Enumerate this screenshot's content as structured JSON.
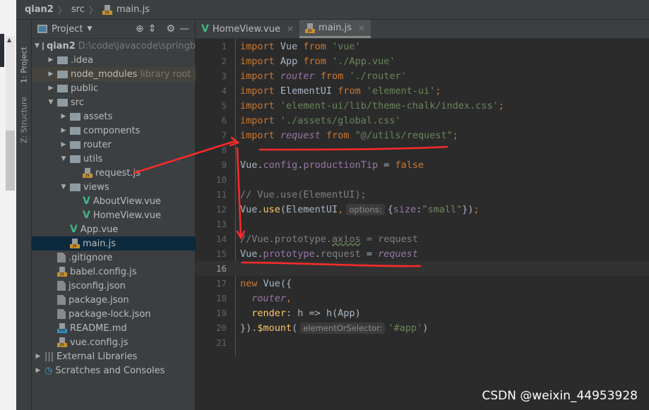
{
  "breadcrumb": [
    "qian2",
    "src",
    "main.js"
  ],
  "toolwindows": {
    "project": "1: Project",
    "structure": "Z: Structure"
  },
  "project_panel": {
    "title": "Project"
  },
  "tree": [
    {
      "label": "qian2",
      "extra": "D:\\code\\javacode\\springb",
      "depth": 0,
      "type": "root",
      "open": true
    },
    {
      "label": ".idea",
      "depth": 1,
      "type": "folder"
    },
    {
      "label": "node_modules",
      "extra": "library root",
      "depth": 1,
      "type": "folder",
      "lib": true
    },
    {
      "label": "public",
      "depth": 1,
      "type": "folder"
    },
    {
      "label": "src",
      "depth": 1,
      "type": "folder",
      "open": true
    },
    {
      "label": "assets",
      "depth": 2,
      "type": "folder"
    },
    {
      "label": "components",
      "depth": 2,
      "type": "folder"
    },
    {
      "label": "router",
      "depth": 2,
      "type": "folder"
    },
    {
      "label": "utils",
      "depth": 2,
      "type": "folder",
      "open": true
    },
    {
      "label": "request.js",
      "depth": 3,
      "type": "js"
    },
    {
      "label": "views",
      "depth": 2,
      "type": "folder",
      "open": true
    },
    {
      "label": "AboutView.vue",
      "depth": 3,
      "type": "vue"
    },
    {
      "label": "HomeView.vue",
      "depth": 3,
      "type": "vue"
    },
    {
      "label": "App.vue",
      "depth": 2,
      "type": "vue"
    },
    {
      "label": "main.js",
      "depth": 2,
      "type": "js",
      "selected": true
    },
    {
      "label": ".gitignore",
      "depth": 1,
      "type": "file"
    },
    {
      "label": "babel.config.js",
      "depth": 1,
      "type": "js"
    },
    {
      "label": "jsconfig.json",
      "depth": 1,
      "type": "file"
    },
    {
      "label": "package.json",
      "depth": 1,
      "type": "file"
    },
    {
      "label": "package-lock.json",
      "depth": 1,
      "type": "file"
    },
    {
      "label": "README.md",
      "depth": 1,
      "type": "md"
    },
    {
      "label": "vue.config.js",
      "depth": 1,
      "type": "js"
    },
    {
      "label": "External Libraries",
      "depth": 0,
      "type": "libs"
    },
    {
      "label": "Scratches and Consoles",
      "depth": 0,
      "type": "scratch"
    }
  ],
  "tabs": [
    {
      "label": "HomeView.vue",
      "icon": "vue-icon"
    },
    {
      "label": "main.js",
      "icon": "js-icon",
      "active": true
    }
  ],
  "current_line": 16,
  "code": [
    [
      [
        "kw",
        "import "
      ],
      [
        "id",
        "Vue "
      ],
      [
        "kw",
        "from "
      ],
      [
        "str",
        "'vue'"
      ]
    ],
    [
      [
        "kw",
        "import "
      ],
      [
        "id",
        "App "
      ],
      [
        "kw",
        "from "
      ],
      [
        "str",
        "'./App.vue'"
      ]
    ],
    [
      [
        "kw",
        "import "
      ],
      [
        "pv",
        "router"
      ],
      [
        "kw",
        " from "
      ],
      [
        "str",
        "'./router'"
      ]
    ],
    [
      [
        "kw",
        "import "
      ],
      [
        "id",
        "ElementUI "
      ],
      [
        "kw",
        "from "
      ],
      [
        "str",
        "'element-ui'"
      ],
      [
        "kw",
        ";"
      ]
    ],
    [
      [
        "kw",
        "import "
      ],
      [
        "str",
        "'element-ui/lib/theme-chalk/index.css'"
      ],
      [
        "kw",
        ";"
      ]
    ],
    [
      [
        "kw",
        "import "
      ],
      [
        "str",
        "'./assets/global.css'"
      ]
    ],
    [
      [
        "kw",
        "import "
      ],
      [
        "pv",
        "request"
      ],
      [
        "kw",
        " from "
      ],
      [
        "str",
        "\"@/utils/request\""
      ],
      [
        "kw",
        ";"
      ]
    ],
    [],
    [
      [
        "id",
        "Vue."
      ],
      [
        "prop",
        "config"
      ],
      [
        "id",
        "."
      ],
      [
        "prop",
        "productionTip"
      ],
      [
        "id",
        " = "
      ],
      [
        "kw",
        "false"
      ]
    ],
    [],
    [
      [
        "cm",
        "// Vue.use(ElementUI);"
      ]
    ],
    [
      [
        "id",
        "Vue."
      ],
      [
        "fn",
        "use"
      ],
      [
        "id",
        "(ElementUI"
      ],
      [
        "kw",
        ","
      ],
      [
        "hint",
        "options:"
      ],
      [
        "id",
        "{"
      ],
      [
        "prop",
        "size"
      ],
      [
        "id",
        ":"
      ],
      [
        "str",
        "\"small\""
      ],
      [
        "id",
        "})"
      ],
      [
        "kw",
        ";"
      ]
    ],
    [],
    [
      [
        "cm",
        "//Vue.prototype."
      ],
      [
        "wavy",
        "axios"
      ],
      [
        "cm",
        " = request"
      ]
    ],
    [
      [
        "id",
        "Vue."
      ],
      [
        "prop",
        "prototype"
      ],
      [
        "id",
        "."
      ],
      [
        "cm",
        "request"
      ],
      [
        "id",
        " = "
      ],
      [
        "pv",
        "request"
      ]
    ],
    [],
    [
      [
        "kw",
        "new "
      ],
      [
        "id",
        "Vue({"
      ]
    ],
    [
      [
        "id",
        "  "
      ],
      [
        "pv",
        "router"
      ],
      [
        "kw",
        ","
      ]
    ],
    [
      [
        "id",
        "  "
      ],
      [
        "fn",
        "render"
      ],
      [
        "id",
        ": h => h(App)"
      ]
    ],
    [
      [
        "id",
        "})."
      ],
      [
        "fn",
        "$mount"
      ],
      [
        "id",
        "("
      ],
      [
        "hint",
        "elementOrSelector:"
      ],
      [
        "str",
        "'#app'"
      ],
      [
        "id",
        ")"
      ]
    ],
    []
  ],
  "watermark": "CSDN @weixin_44953928",
  "annotation_color": "#ff2a2a"
}
